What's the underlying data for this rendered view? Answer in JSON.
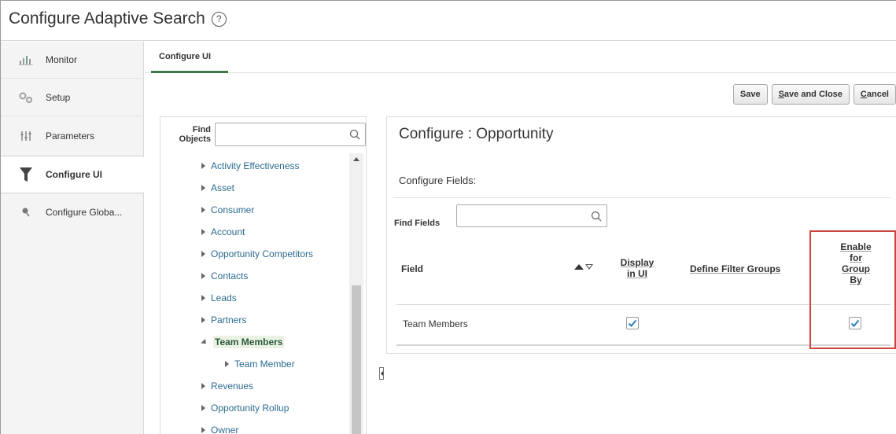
{
  "page": {
    "title": "Configure Adaptive Search",
    "help_glyph": "?"
  },
  "nav": {
    "items": [
      {
        "label": "Monitor",
        "icon": "bar-chart-icon"
      },
      {
        "label": "Setup",
        "icon": "gears-icon"
      },
      {
        "label": "Parameters",
        "icon": "sliders-icon"
      },
      {
        "label": "Configure UI",
        "icon": "funnel-icon",
        "active": true
      },
      {
        "label": "Configure Globa...",
        "icon": "pin-icon"
      }
    ]
  },
  "tabs": [
    {
      "label": "Configure UI",
      "selected": true
    }
  ],
  "toolbar": {
    "save": "Save",
    "save_and_close_first": "S",
    "save_and_close_rest": "ave and Close",
    "cancel_first": "C",
    "cancel_rest": "ancel"
  },
  "objects": {
    "find_label": "Find Objects",
    "find_value": "",
    "tree": [
      {
        "label": "Activity Effectiveness",
        "level": 1,
        "expanded": false
      },
      {
        "label": "Asset",
        "level": 1,
        "expanded": false
      },
      {
        "label": "Consumer",
        "level": 1,
        "expanded": false
      },
      {
        "label": "Account",
        "level": 1,
        "expanded": false
      },
      {
        "label": "Opportunity Competitors",
        "level": 1,
        "expanded": false
      },
      {
        "label": "Contacts",
        "level": 1,
        "expanded": false
      },
      {
        "label": "Leads",
        "level": 1,
        "expanded": false
      },
      {
        "label": "Partners",
        "level": 1,
        "expanded": false
      },
      {
        "label": "Team Members",
        "level": 1,
        "expanded": true,
        "selected": true
      },
      {
        "label": "Team Member",
        "level": 2,
        "expanded": false
      },
      {
        "label": "Revenues",
        "level": 1,
        "expanded": false
      },
      {
        "label": "Opportunity Rollup",
        "level": 1,
        "expanded": false
      },
      {
        "label": "Owner",
        "level": 1,
        "expanded": false
      }
    ]
  },
  "config": {
    "title": "Configure : Opportunity",
    "fields_label": "Configure Fields:",
    "find_fields_label": "Find Fields",
    "find_fields_value": "",
    "columns": {
      "field": "Field",
      "display_line1": "Display",
      "display_line2": "in UI",
      "filter_groups": "Define Filter Groups",
      "enable_line1": "Enable",
      "enable_line2": "for",
      "enable_line3": "Group",
      "enable_line4": "By"
    },
    "rows": [
      {
        "field": "Team Members",
        "display_in_ui": true,
        "enable_group_by": true
      }
    ]
  },
  "colors": {
    "accent_green": "#3c7a4d",
    "link_blue": "#2a6a8f",
    "checkbox_blue": "#2a7fc1",
    "highlight_red": "#c9443c"
  }
}
